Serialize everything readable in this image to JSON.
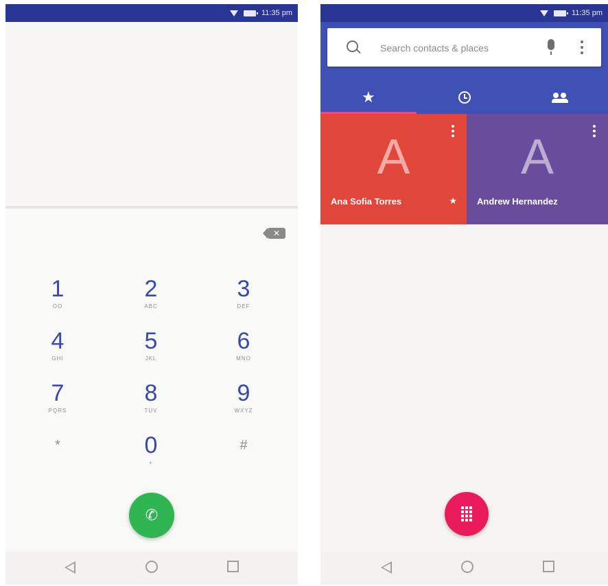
{
  "left": {
    "status_time": "11:35 pm",
    "keypad": [
      {
        "digit": "1",
        "letters": "OO"
      },
      {
        "digit": "2",
        "letters": "ABC"
      },
      {
        "digit": "3",
        "letters": "DEF"
      },
      {
        "digit": "4",
        "letters": "GHI"
      },
      {
        "digit": "5",
        "letters": "JKL"
      },
      {
        "digit": "6",
        "letters": "MNO"
      },
      {
        "digit": "7",
        "letters": "PQRS"
      },
      {
        "digit": "8",
        "letters": "TUV"
      },
      {
        "digit": "9",
        "letters": "WXYZ"
      },
      {
        "digit": "*",
        "letters": ""
      },
      {
        "digit": "0",
        "letters": "+"
      },
      {
        "digit": "#",
        "letters": ""
      }
    ],
    "backspace_glyph": "✕",
    "call_glyph": "✆"
  },
  "right": {
    "status_time": "11:35 pm",
    "search": {
      "placeholder": "Search contacts & places"
    },
    "tabs": [
      {
        "name": "favorites",
        "glyph": "★"
      },
      {
        "name": "recents",
        "glyph": ""
      },
      {
        "name": "contacts",
        "glyph": ""
      }
    ],
    "favorites": [
      {
        "name": "Ana Sofia Torres",
        "letter": "A",
        "color": "#e0463a",
        "starred": true
      },
      {
        "name": "Andrew Hernandez",
        "letter": "A",
        "color": "#6a4c9c",
        "starred": false
      }
    ]
  },
  "colors": {
    "status_bar": "#283593",
    "header": "#3f51b5",
    "accent": "#ff4081",
    "call_green": "#2fb552",
    "fab_pink": "#ea1b5a"
  }
}
